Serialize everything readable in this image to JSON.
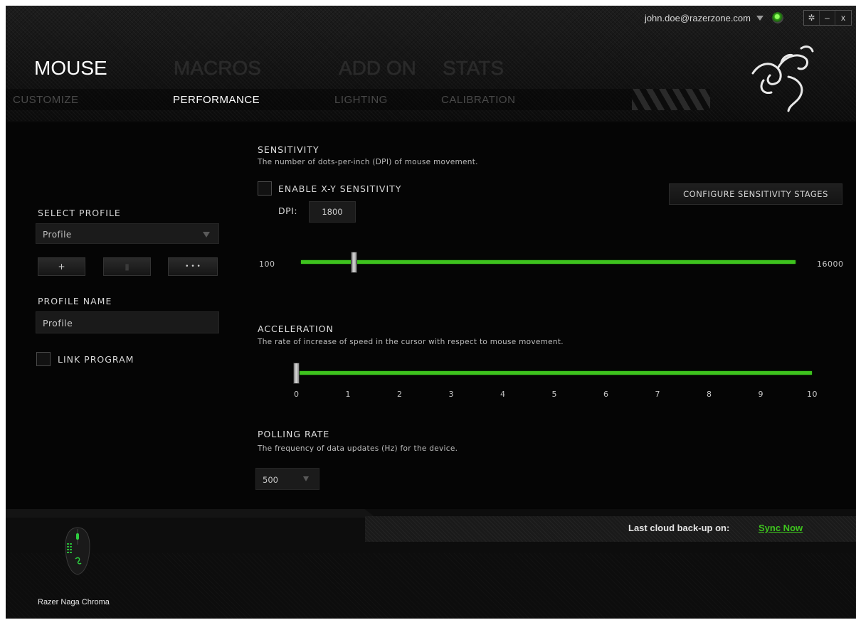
{
  "topbar": {
    "email": "john.doe@razerzone.com",
    "settings_label": "✲",
    "minimize_label": "–",
    "close_label": "x"
  },
  "main_tabs": [
    {
      "label": "MOUSE",
      "active": true
    },
    {
      "label": "MACROS",
      "active": false
    },
    {
      "label": "ADD ON",
      "active": false
    },
    {
      "label": "STATS",
      "active": false
    }
  ],
  "sub_tabs": [
    {
      "label": "CUSTOMIZE",
      "active": false
    },
    {
      "label": "PERFORMANCE",
      "active": true
    },
    {
      "label": "LIGHTING",
      "active": false
    },
    {
      "label": "CALIBRATION",
      "active": false
    }
  ],
  "left_panel": {
    "select_profile_label": "SELECT PROFILE",
    "profile_select_value": "Profile",
    "add_button": "+",
    "delete_button": "▮",
    "more_button": "• • •",
    "profile_name_label": "PROFILE NAME",
    "profile_name_value": "Profile",
    "link_program_label": "LINK PROGRAM",
    "link_program_checked": false
  },
  "sensitivity": {
    "title": "SENSITIVITY",
    "description": "The number of dots-per-inch (DPI) of mouse movement.",
    "enable_xy_label": "ENABLE X-Y SENSITIVITY",
    "enable_xy_checked": false,
    "dpi_label": "DPI:",
    "dpi_value": "1800",
    "configure_button": "CONFIGURE SENSITIVITY STAGES",
    "slider_min": "100",
    "slider_max": "16000",
    "slider_value": 1800
  },
  "acceleration": {
    "title": "ACCELERATION",
    "description": "The rate of increase of speed in the cursor with respect to mouse movement.",
    "ticks": [
      "0",
      "1",
      "2",
      "3",
      "4",
      "5",
      "6",
      "7",
      "8",
      "9",
      "10"
    ],
    "value": 0
  },
  "polling_rate": {
    "title": "POLLING RATE",
    "description": "The frequency of data updates (Hz) for the device.",
    "value": "500"
  },
  "footer": {
    "backup_label": "Last cloud back-up on:",
    "sync_link": "Sync Now",
    "device_name": "Razer Naga Chroma"
  },
  "colors": {
    "accent_green": "#3ec31e",
    "background": "#050505"
  }
}
